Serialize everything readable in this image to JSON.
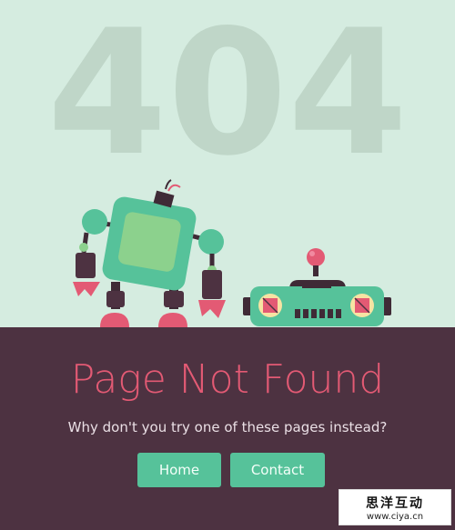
{
  "error_code": "404",
  "heading": "Page Not Found",
  "subtitle": "Why don't you try one of these pages instead?",
  "buttons": {
    "home_label": "Home",
    "contact_label": "Contact"
  },
  "watermark": {
    "cn_text": "思洋互动",
    "url": "www.ciya.cn"
  },
  "colors": {
    "background": "#d5ece0",
    "ground": "#4d3241",
    "heading": "#e35a74",
    "button": "#56c29a",
    "big_number": "#bfd6c8"
  }
}
